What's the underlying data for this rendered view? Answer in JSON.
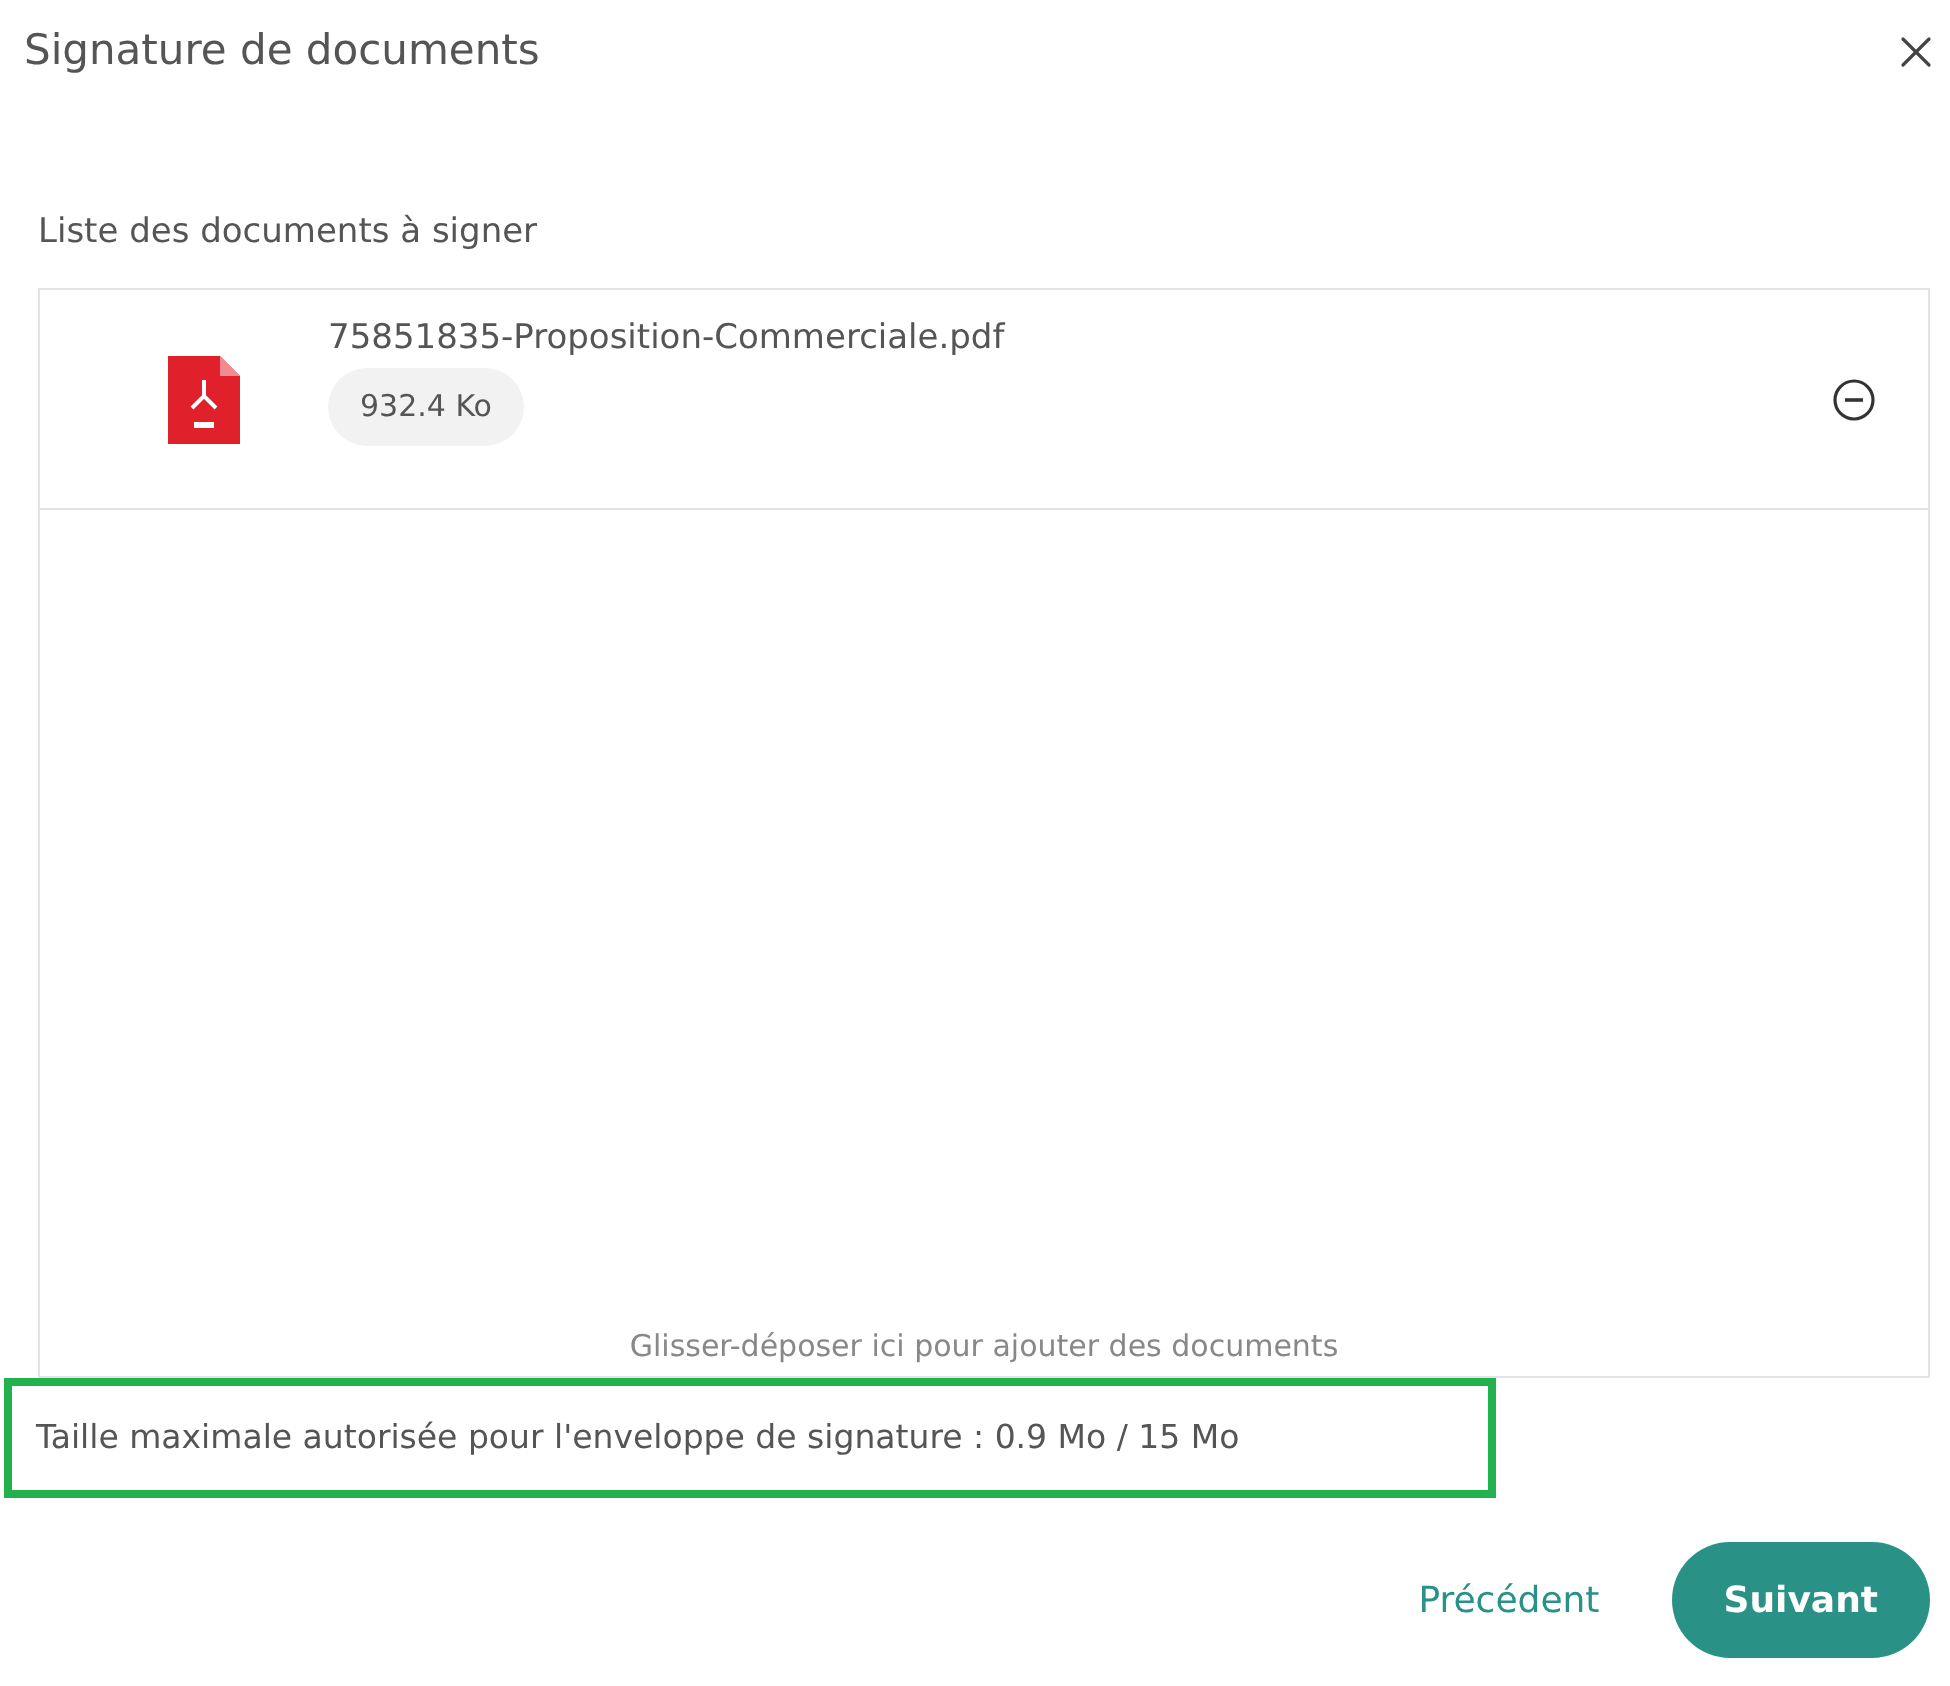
{
  "dialog": {
    "title": "Signature de documents"
  },
  "section_label": "Liste des documents à signer",
  "documents": [
    {
      "name": "75851835-Proposition-Commerciale.pdf",
      "size": "932.4 Ko"
    }
  ],
  "drop_hint": "Glisser-déposer ici pour ajouter des documents",
  "size_limit": "Taille maximale autorisée pour l'enveloppe de signature : 0.9 Mo / 15 Mo",
  "buttons": [
    {
      "label": "Précédent",
      "kind": "link"
    },
    {
      "label": "Suivant",
      "kind": "primary"
    }
  ]
}
